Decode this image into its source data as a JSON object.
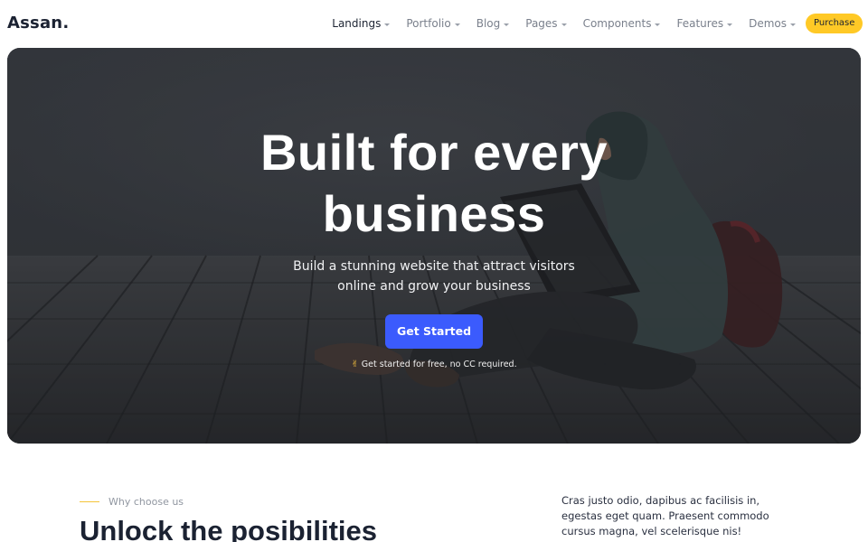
{
  "brand": "Assan.",
  "nav": {
    "items": [
      {
        "label": "Landings",
        "active": true
      },
      {
        "label": "Portfolio"
      },
      {
        "label": "Blog"
      },
      {
        "label": "Pages"
      },
      {
        "label": "Components"
      },
      {
        "label": "Features"
      },
      {
        "label": "Demos"
      }
    ],
    "purchase_label": "Purchase"
  },
  "hero": {
    "title_line1": "Built for every",
    "title_line2": "business",
    "subtitle_line1": "Build a stunning website that attract visitors",
    "subtitle_line2": "online and grow your business",
    "cta_label": "Get Started",
    "note_icon": "✌",
    "note_text": "Get started for free, no CC required."
  },
  "why": {
    "eyebrow": "Why choose us",
    "title": "Unlock the posibilities",
    "paragraph": "Cras justo odio, dapibus ac facilisis in, egestas eget quam. Praesent commodo cursus magna, vel scelerisque nis!"
  },
  "colors": {
    "accent": "#3b5bfd",
    "purchase": "#ffc926",
    "eyebrow_line": "#f4c43a"
  }
}
